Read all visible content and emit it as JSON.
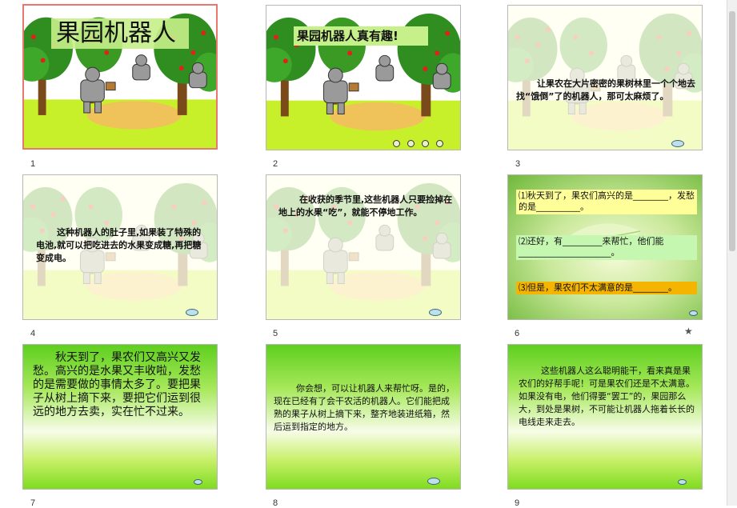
{
  "slides": [
    {
      "number": "1",
      "title": "果园机器人"
    },
    {
      "number": "2",
      "title": "果园机器人真有趣!"
    },
    {
      "number": "3",
      "text": "让果农在大片密密的果树林里一个个地去找“饿倒”了的机器人，那可太麻烦了。"
    },
    {
      "number": "4",
      "text": "这种机器人的肚子里,如果装了特殊的电池,就可以把吃进去的水果变成糖,再把糖变成电。"
    },
    {
      "number": "5",
      "text": "在收获的季节里,这些机器人只要捡掉在地上的水果“吃”，就能不停地工作。"
    },
    {
      "number": "6",
      "questions": [
        "⑴秋天到了，果农们高兴的是________，发愁的是__________。",
        "⑵还好，有_________来帮忙，他们能_____________________。",
        "⑶但是，果农们不太满意的是________。"
      ]
    },
    {
      "number": "7",
      "text": "秋天到了，果农们又高兴又发愁。高兴的是水果又丰收啦，发愁的是需要做的事情太多了。要把果子从树上摘下来，要把它们运到很远的地方去卖，实在忙不过来。"
    },
    {
      "number": "8",
      "text": "你会想，可以让机器人来帮忙呀。是的，现在已经有了会干农活的机器人。它们能把成熟的果子从树上摘下来，整齐地装进纸箱，然后运到指定的地方。"
    },
    {
      "number": "9",
      "text": "这些机器人这么聪明能干，看来真是果农们的好帮手呢！可是果农们还是不太满意。如果没有电，他们得要“罢工”的，果园那么大，到处是果树，不可能让机器人拖着长长的电线走来走去。"
    }
  ],
  "star_icon": "★",
  "colors": {
    "selected_border": "#e9776e",
    "title_box": "#c6f08a",
    "question_yellow": "#ffff99",
    "question_green": "#c6f7b0",
    "question_orange": "#f5b400"
  }
}
